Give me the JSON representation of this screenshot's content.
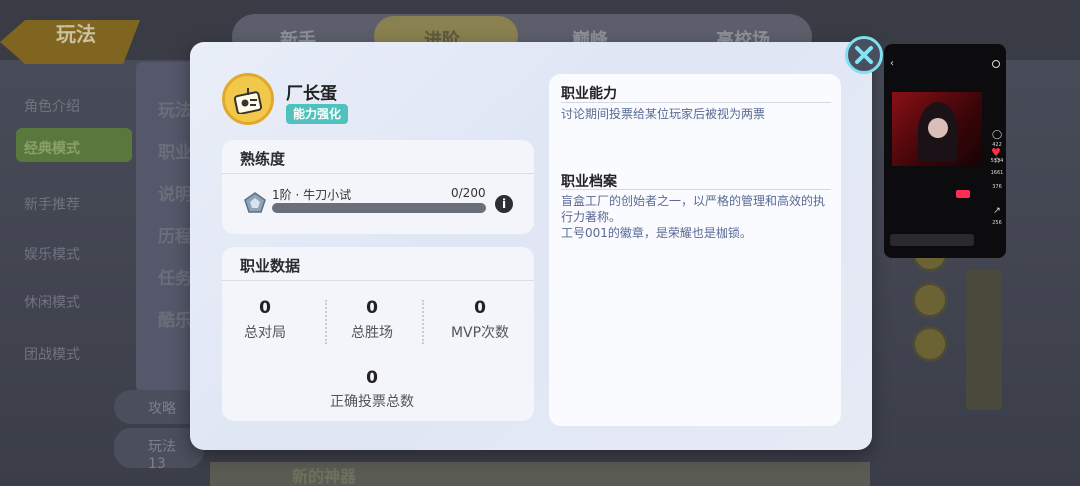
{
  "background": {
    "back_label": "玩法",
    "tabs": [
      "新手",
      "进阶",
      "巅峰",
      "高校场"
    ],
    "side_items": [
      "角色介绍",
      "经典模式",
      "新手推荐",
      "娱乐模式",
      "休闲模式",
      "团战模式"
    ],
    "panel_items": [
      "玩法",
      "职业",
      "说明",
      "历程",
      "任务",
      "酷乐"
    ],
    "bottom_buttons": [
      "攻略",
      "玩法"
    ],
    "bottom_count": "13",
    "bottom_banner": "新的神器"
  },
  "dialog": {
    "role": {
      "name": "厂长蛋",
      "tag": "能力强化"
    },
    "proficiency": {
      "title": "熟练度",
      "level_label": "1阶 · 牛刀小试",
      "value_text": "0/200",
      "progress": 0
    },
    "stats": {
      "title": "职业数据",
      "items": [
        {
          "value": "0",
          "label": "总对局"
        },
        {
          "value": "0",
          "label": "总胜场"
        },
        {
          "value": "0",
          "label": "MVP次数"
        },
        {
          "value": "0",
          "label": "正确投票总数"
        }
      ]
    },
    "ability": {
      "title": "职业能力",
      "text": "讨论期间投票给某位玩家后被视为两票"
    },
    "archive": {
      "title": "职业档案",
      "lines": [
        "盲盒工厂的创始者之一，以严格的管理和高效的执行力著称。",
        "工号001的徽章，是荣耀也是枷锁。"
      ]
    }
  },
  "phone": {
    "counts": [
      "5334",
      "422",
      "1661",
      "376",
      "256"
    ]
  },
  "colors": {
    "accent_teal": "#4fc2bd",
    "avatar_gold": "#f2c84b",
    "info_text": "#5a6a96"
  },
  "icons": {
    "close": "close-icon",
    "info": "info-icon",
    "avatar": "id-badge-icon",
    "level": "pentagon-rank-icon"
  }
}
